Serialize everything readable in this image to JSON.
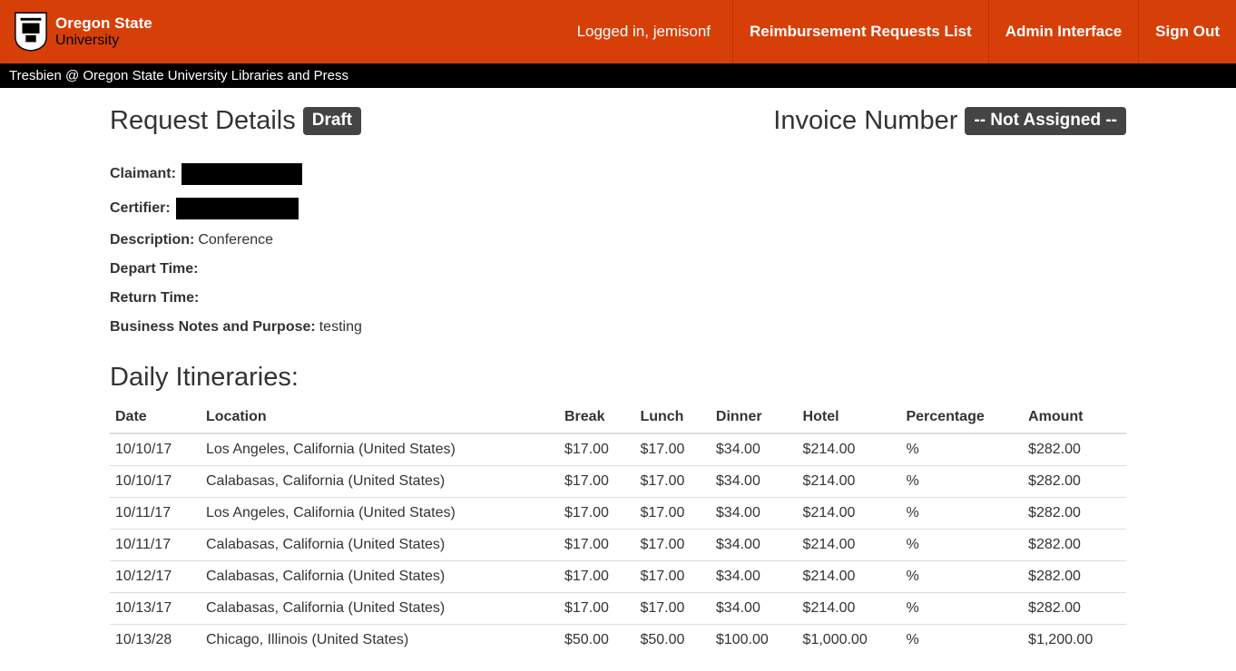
{
  "logo": {
    "line1": "Oregon State",
    "line2": "University"
  },
  "header": {
    "logged_in": "Logged in, jemisonf",
    "nav": {
      "requests": "Reimbursement Requests List",
      "admin": "Admin Interface",
      "signout": "Sign Out"
    }
  },
  "subheader": "Tresbien @ Oregon State University Libraries and Press",
  "titles": {
    "request_details": "Request Details",
    "draft_badge": "Draft",
    "invoice_number": "Invoice Number",
    "invoice_badge": "-- Not Assigned --"
  },
  "labels": {
    "claimant": "Claimant:",
    "certifier": "Certifier:",
    "description": "Description:",
    "depart": "Depart Time:",
    "return": "Return Time:",
    "notes": "Business Notes and Purpose:"
  },
  "values": {
    "description": "Conference",
    "depart": "",
    "return": "",
    "notes": "testing"
  },
  "itineraries_title": "Daily Itineraries:",
  "columns": {
    "date": "Date",
    "location": "Location",
    "break": "Break",
    "lunch": "Lunch",
    "dinner": "Dinner",
    "hotel": "Hotel",
    "percentage": "Percentage",
    "amount": "Amount"
  },
  "rows": [
    {
      "date": "10/10/17",
      "location": "Los Angeles, California (United States)",
      "break": "$17.00",
      "lunch": "$17.00",
      "dinner": "$34.00",
      "hotel": "$214.00",
      "percentage": "%",
      "amount": "$282.00"
    },
    {
      "date": "10/10/17",
      "location": "Calabasas, California (United States)",
      "break": "$17.00",
      "lunch": "$17.00",
      "dinner": "$34.00",
      "hotel": "$214.00",
      "percentage": "%",
      "amount": "$282.00"
    },
    {
      "date": "10/11/17",
      "location": "Los Angeles, California (United States)",
      "break": "$17.00",
      "lunch": "$17.00",
      "dinner": "$34.00",
      "hotel": "$214.00",
      "percentage": "%",
      "amount": "$282.00"
    },
    {
      "date": "10/11/17",
      "location": "Calabasas, California (United States)",
      "break": "$17.00",
      "lunch": "$17.00",
      "dinner": "$34.00",
      "hotel": "$214.00",
      "percentage": "%",
      "amount": "$282.00"
    },
    {
      "date": "10/12/17",
      "location": "Calabasas, California (United States)",
      "break": "$17.00",
      "lunch": "$17.00",
      "dinner": "$34.00",
      "hotel": "$214.00",
      "percentage": "%",
      "amount": "$282.00"
    },
    {
      "date": "10/13/17",
      "location": "Calabasas, California (United States)",
      "break": "$17.00",
      "lunch": "$17.00",
      "dinner": "$34.00",
      "hotel": "$214.00",
      "percentage": "%",
      "amount": "$282.00"
    },
    {
      "date": "10/13/28",
      "location": "Chicago, Illinois (United States)",
      "break": "$50.00",
      "lunch": "$50.00",
      "dinner": "$100.00",
      "hotel": "$1,000.00",
      "percentage": "%",
      "amount": "$1,200.00"
    }
  ]
}
